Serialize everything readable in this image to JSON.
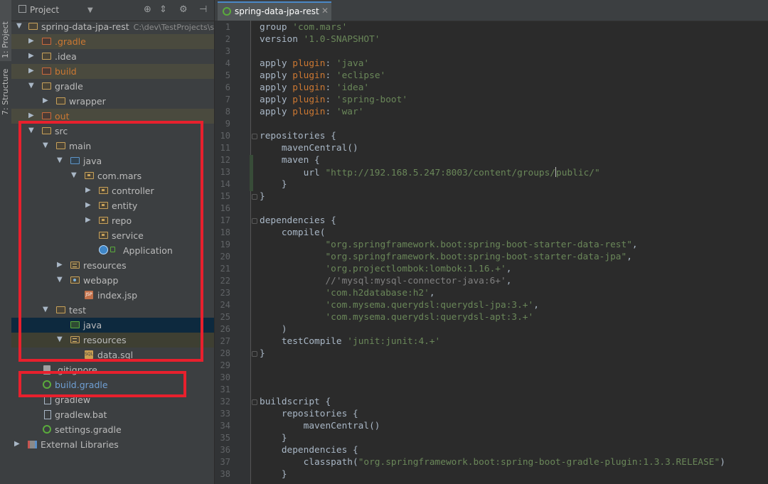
{
  "side_tabs": {
    "project": "1: Project",
    "structure": "7: Structure"
  },
  "panel": {
    "title": "Project",
    "dropdown_icon": "chevron-down-icon",
    "toolbar_icons": [
      "locate-icon",
      "collapse-icon",
      "gear-icon",
      "hide-icon"
    ]
  },
  "tree": {
    "root_name": "spring-data-jpa-rest",
    "root_path": "C:\\dev\\TestProjects\\s",
    "items": [
      "spring-data-jpa-rest",
      ".gradle",
      ".idea",
      "build",
      "gradle",
      "wrapper",
      "out",
      "src",
      "main",
      "java",
      "com.mars",
      "controller",
      "entity",
      "repo",
      "service",
      "Application",
      "resources",
      "webapp",
      "index.jsp",
      "test",
      "java",
      "resources",
      "data.sql",
      ".gitignore",
      "build.gradle",
      "gradlew",
      "gradlew.bat",
      "settings.gradle",
      "External Libraries"
    ]
  },
  "editor": {
    "tab_label": "spring-data-jpa-rest",
    "line_numbers": [
      "1",
      "2",
      "3",
      "4",
      "5",
      "6",
      "7",
      "8",
      "9",
      "10",
      "11",
      "12",
      "13",
      "14",
      "15",
      "16",
      "17",
      "18",
      "19",
      "20",
      "21",
      "22",
      "23",
      "24",
      "25",
      "26",
      "27",
      "28",
      "29",
      "30",
      "31",
      "32",
      "33",
      "34",
      "35",
      "36",
      "37",
      "38"
    ],
    "code": {
      "group_value": "'com.mars'",
      "version_value": "'1.0-SNAPSHOT'",
      "plugins": [
        "'java'",
        "'eclipse'",
        "'idea'",
        "'spring-boot'",
        "'war'"
      ],
      "maven_url_a": "\"http://192.168.5.247:8003/content/groups/",
      "maven_url_b": "public/\"",
      "deps": [
        "\"org.springframework.boot:spring-boot-starter-data-rest\"",
        "\"org.springframework.boot:spring-boot-starter-data-jpa\"",
        "'org.projectlombok:lombok:1.16.+'",
        "//'mysql:mysql-connector-java:6+'",
        "'com.h2database:h2'",
        "'com.mysema.querydsl:querydsl-jpa:3.+'",
        "'com.mysema.querydsl:querydsl-apt:3.+'"
      ],
      "junit": "'junit:junit:4.+'",
      "classpath_value": "\"org.springframework.boot:spring-boot-gradle-plugin:1.3.3.RELEASE\""
    }
  },
  "colors": {
    "highlight_box": "#e8202d",
    "keyword": "#cc7832",
    "string": "#6a8759",
    "text": "#a9b7c6"
  }
}
